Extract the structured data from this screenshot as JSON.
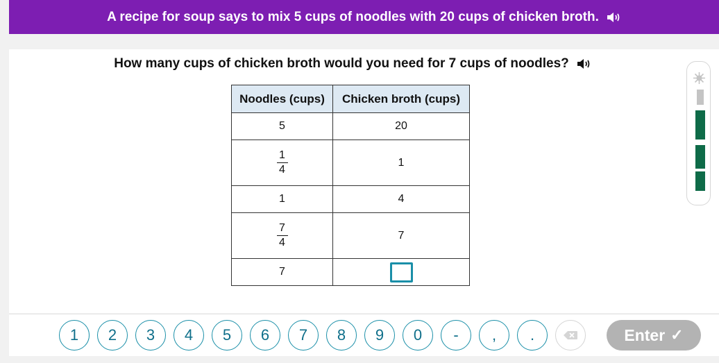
{
  "banner": {
    "text": "A recipe for soup says to mix 5 cups of noodles with 20 cups of chicken broth."
  },
  "question": {
    "text": "How many cups of chicken broth would you need for 7 cups of noodles?"
  },
  "table": {
    "headers": [
      "Noodles (cups)",
      "Chicken broth (cups)"
    ],
    "rows": [
      {
        "noodles": "5",
        "broth": "20"
      },
      {
        "noodles_num": "1",
        "noodles_den": "4",
        "broth": "1"
      },
      {
        "noodles": "1",
        "broth": "4"
      },
      {
        "noodles_num": "7",
        "noodles_den": "4",
        "broth": "7"
      },
      {
        "noodles": "7",
        "broth": ""
      }
    ]
  },
  "progress": {
    "filled_segments": 3,
    "total_segments": 4,
    "fill_color": "#0e6b48"
  },
  "keypad": {
    "keys": [
      "1",
      "2",
      "3",
      "4",
      "5",
      "6",
      "7",
      "8",
      "9",
      "0",
      "-",
      ",",
      "."
    ],
    "enter_label": "Enter",
    "enter_icon": "checkmark-icon",
    "delete_icon": "backspace-icon"
  },
  "colors": {
    "banner": "#7d1eb2",
    "accent": "#1a8fa8",
    "header_fill": "#dde9f3",
    "enter_disabled": "#b3b3b3"
  }
}
